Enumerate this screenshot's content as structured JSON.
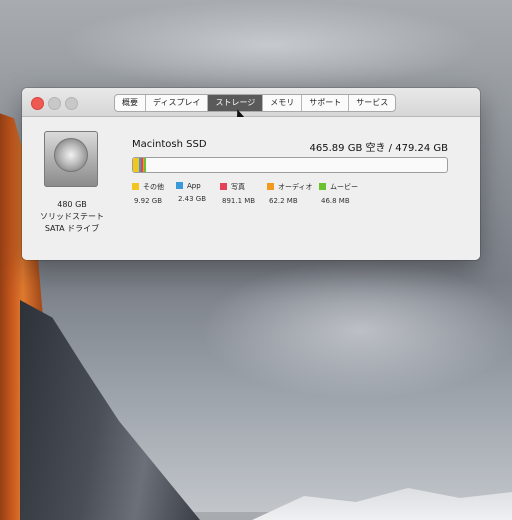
{
  "window": {
    "tabs": [
      {
        "label": "概要",
        "active": false
      },
      {
        "label": "ディスプレイ",
        "active": false
      },
      {
        "label": "ストレージ",
        "active": true
      },
      {
        "label": "メモリ",
        "active": false
      },
      {
        "label": "サポート",
        "active": false
      },
      {
        "label": "サービス",
        "active": false
      }
    ]
  },
  "disk": {
    "size": "480 GB",
    "type": "ソリッドステート",
    "interface": "SATA ドライブ",
    "icon": "hard-drive-icon"
  },
  "storage": {
    "drive_name": "Macintosh SSD",
    "capacity": "465.89 GB 空き / 479.24 GB",
    "total_gb": 479.24,
    "categories": [
      {
        "label": "その他",
        "size": "9.92 GB",
        "gb": 9.92,
        "color": "#f3c51f"
      },
      {
        "label": "App",
        "size": "2.43 GB",
        "gb": 2.43,
        "color": "#3a9ad9"
      },
      {
        "label": "写真",
        "size": "891.1 MB",
        "gb": 0.8911,
        "color": "#e5415a"
      },
      {
        "label": "オーディオ",
        "size": "62.2 MB",
        "gb": 0.0622,
        "color": "#f39a1e"
      },
      {
        "label": "ムービー",
        "size": "46.8 MB",
        "gb": 0.0468,
        "color": "#6ac22e"
      }
    ]
  }
}
